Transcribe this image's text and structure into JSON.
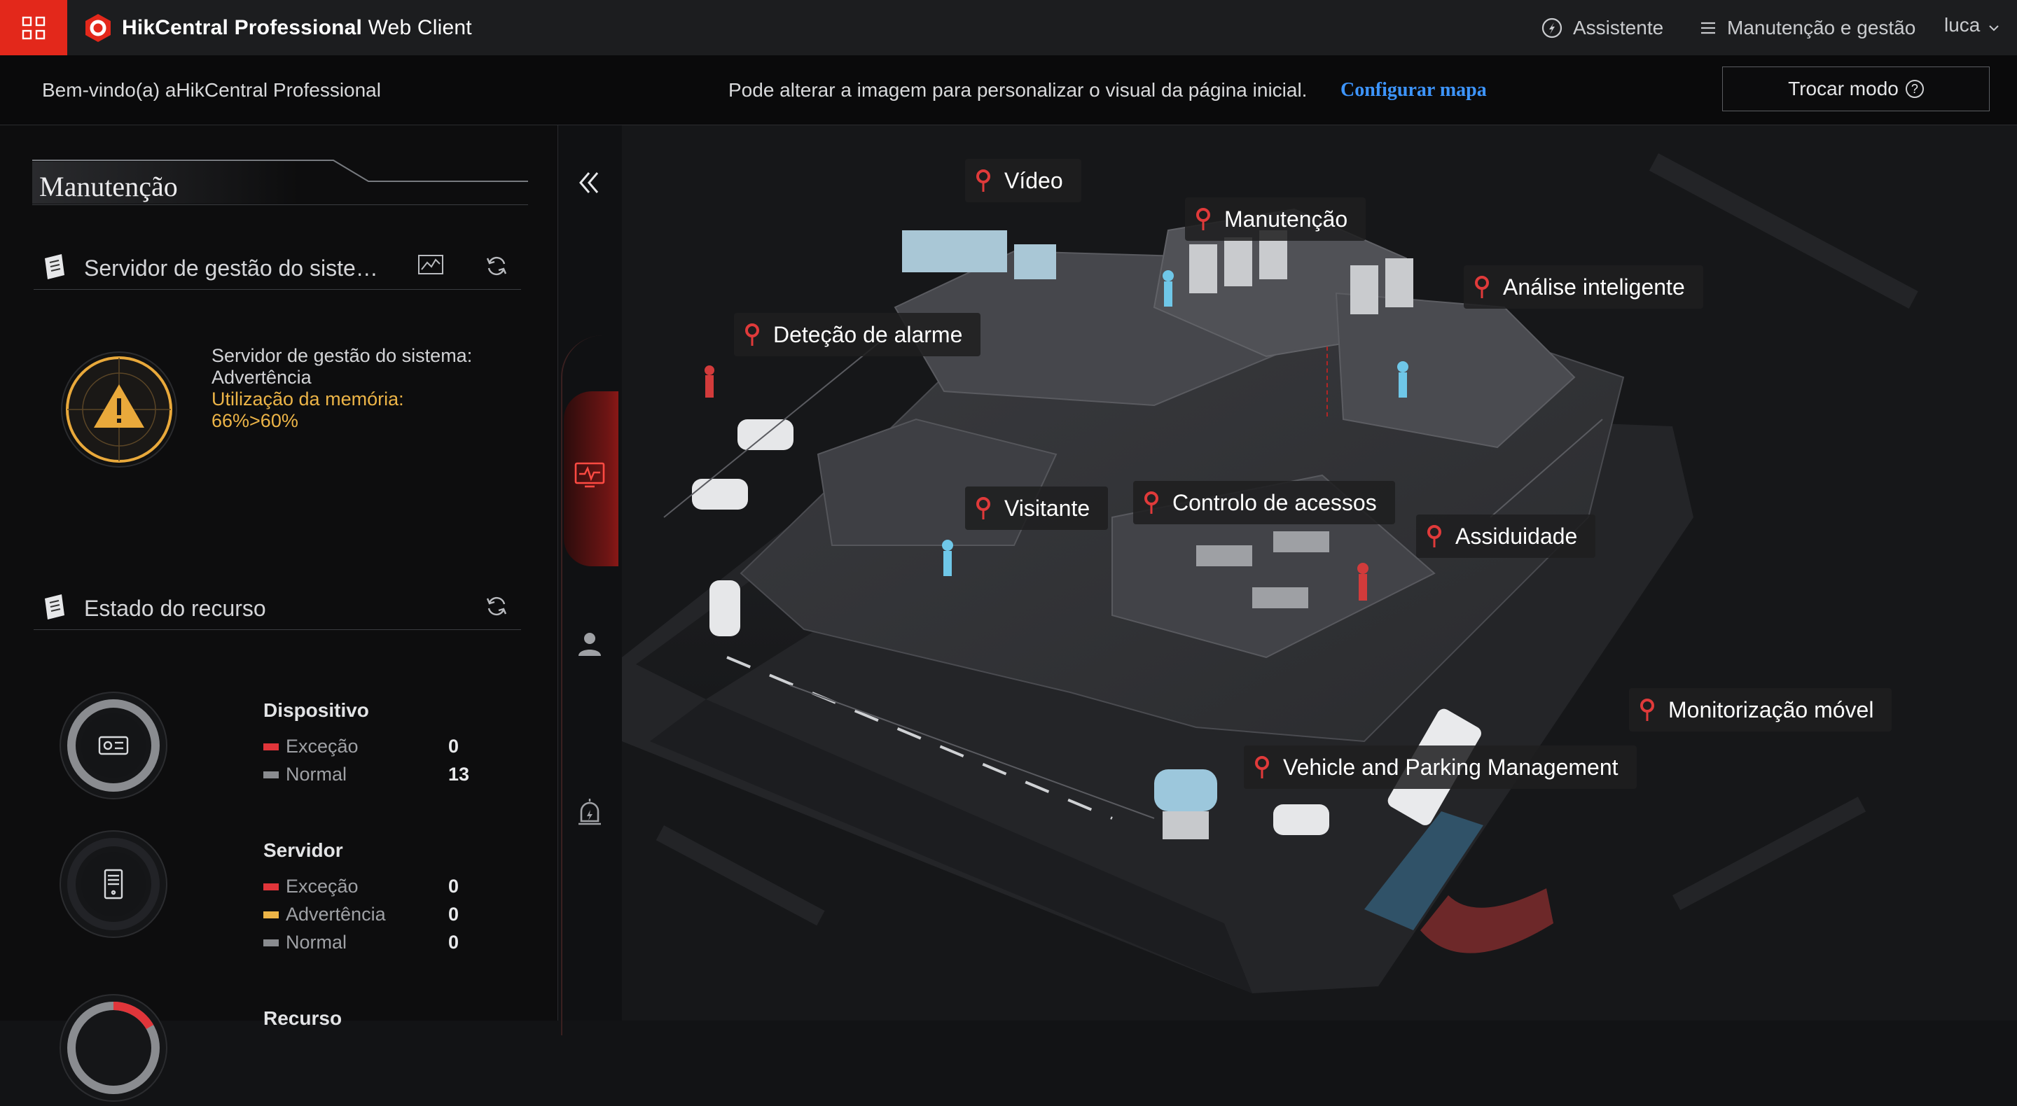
{
  "header": {
    "brand_bold": "HikCentral Professional",
    "brand_rest": " Web Client",
    "assistant_label": "Assistente",
    "maintenance_label": "Manutenção e gestão",
    "user_name": "luca"
  },
  "welcome": {
    "greeting": "Bem-vindo(a) aHikCentral Professional",
    "hint": "Pode alterar a imagem para personalizar o visual da página inicial.",
    "configure_map": "Configurar mapa",
    "switch_mode": "Trocar modo"
  },
  "left_panel": {
    "title": "Manutenção",
    "server_section": "Servidor de gestão do siste…",
    "status_line1": "Servidor de gestão do sistema:",
    "status_line2": "Advertência",
    "memory_line1": "Utilização da memória:",
    "memory_line2": "66%>60%",
    "resource_section": "Estado do recurso",
    "device": {
      "title": "Dispositivo",
      "exception_label": "Exceção",
      "exception_value": "0",
      "normal_label": "Normal",
      "normal_value": "13"
    },
    "server": {
      "title": "Servidor",
      "exception_label": "Exceção",
      "exception_value": "0",
      "warning_label": "Advertência",
      "warning_value": "0",
      "normal_label": "Normal",
      "normal_value": "0"
    },
    "resource": {
      "title": "Recurso"
    }
  },
  "scene_labels": {
    "video": "Vídeo",
    "maintenance": "Manutenção",
    "smart_analysis": "Análise inteligente",
    "alarm_detection": "Deteção de alarme",
    "visitor": "Visitante",
    "access_control": "Controlo de acessos",
    "attendance": "Assiduidade",
    "mobile_monitoring": "Monitorização móvel",
    "vehicle_parking": "Vehicle and Parking Management"
  },
  "colors": {
    "accent_red": "#e3281b",
    "link_blue": "#3d95ff",
    "warning_amber": "#ecb447",
    "exception_red": "#e0353a",
    "normal_gray": "#8a8c90"
  }
}
